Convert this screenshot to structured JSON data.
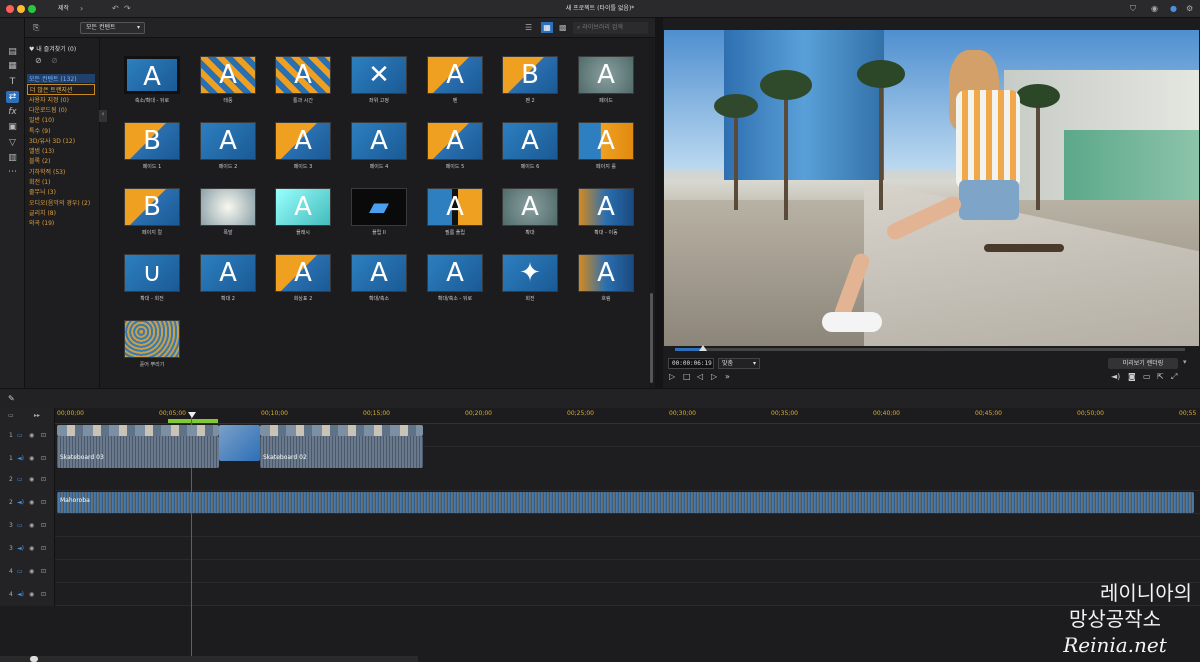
{
  "titlebar": {
    "tab": "제작",
    "title": "새 프로젝트 (타이틀 없음)*"
  },
  "library": {
    "filter": "모든 컨텐트",
    "search_placeholder": "라이브러리 검색",
    "favorites": "내 즐겨찾기 (0)",
    "categories": [
      "모든 컨텐트 (132)",
      "더 많은 트랜지션",
      "사용자 지정 (0)",
      "다운로드됨 (0)",
      "일반 (10)",
      "특수 (9)",
      "3D/유사 3D (12)",
      "앨범 (13)",
      "블록 (2)",
      "기하학적 (53)",
      "회전 (1)",
      "줄무늬 (3)",
      "오디오(음악의 경우) (2)",
      "글리치 (8)",
      "와곡 (19)"
    ],
    "tiles": [
      {
        "label": "축소/확대 - 뒤로",
        "style": "dark-a"
      },
      {
        "label": "태풍",
        "style": "pattern"
      },
      {
        "label": "통과 시간",
        "style": "pattern"
      },
      {
        "label": "좌위 고정",
        "style": "blue-x"
      },
      {
        "label": "펜",
        "style": "orange"
      },
      {
        "label": "펜 2",
        "style": "orange-b"
      },
      {
        "label": "페이드",
        "style": "gray"
      },
      {
        "label": "페이드 1",
        "style": "orange-b"
      },
      {
        "label": "페이드 2",
        "style": "blue"
      },
      {
        "label": "페이드 3",
        "style": "orange"
      },
      {
        "label": "페이드 4",
        "style": "blue"
      },
      {
        "label": "페이드 5",
        "style": "orange"
      },
      {
        "label": "페이드 6",
        "style": "blue"
      },
      {
        "label": "페이지 롤",
        "style": "orange2"
      },
      {
        "label": "페이지 컬",
        "style": "orange-b"
      },
      {
        "label": "폭발",
        "style": "white"
      },
      {
        "label": "플래시",
        "style": "cyan"
      },
      {
        "label": "플립 II",
        "style": "dark"
      },
      {
        "label": "필름 플립",
        "style": "film"
      },
      {
        "label": "확대",
        "style": "gray"
      },
      {
        "label": "확대 - 이동",
        "style": "fade"
      },
      {
        "label": "확대 - 회전",
        "style": "blue-u"
      },
      {
        "label": "확대 2",
        "style": "blue"
      },
      {
        "label": "회상표 2",
        "style": "orange"
      },
      {
        "label": "확대/축소",
        "style": "blue"
      },
      {
        "label": "확대/축소 - 뒤로",
        "style": "blue"
      },
      {
        "label": "회전",
        "style": "blue-o"
      },
      {
        "label": "흐림",
        "style": "blue-fade"
      },
      {
        "label": "흩어 뿌리기",
        "style": "dots"
      }
    ]
  },
  "preview": {
    "timecode": "00:00:06:19",
    "fit": "맞춤",
    "quality_btn": "미리보기 렌더링"
  },
  "timeline": {
    "ticks": [
      "00;00;00",
      "00;05;00",
      "00;10;00",
      "00;15;00",
      "00;20;00",
      "00;25;00",
      "00;30;00",
      "00;35;00",
      "00;40;00",
      "00;45;00",
      "00;50;00",
      "00;55"
    ],
    "tracks": [
      "1",
      "1",
      "2",
      "2",
      "3",
      "3",
      "4",
      "4"
    ],
    "clips": {
      "video1": "Skateboard 03",
      "video2": "Skateboard 02",
      "audio": "Mahoroba"
    }
  },
  "watermark": {
    "line1": "레이니아의",
    "line2": "망상공작소",
    "line3": "Reinia.net"
  }
}
